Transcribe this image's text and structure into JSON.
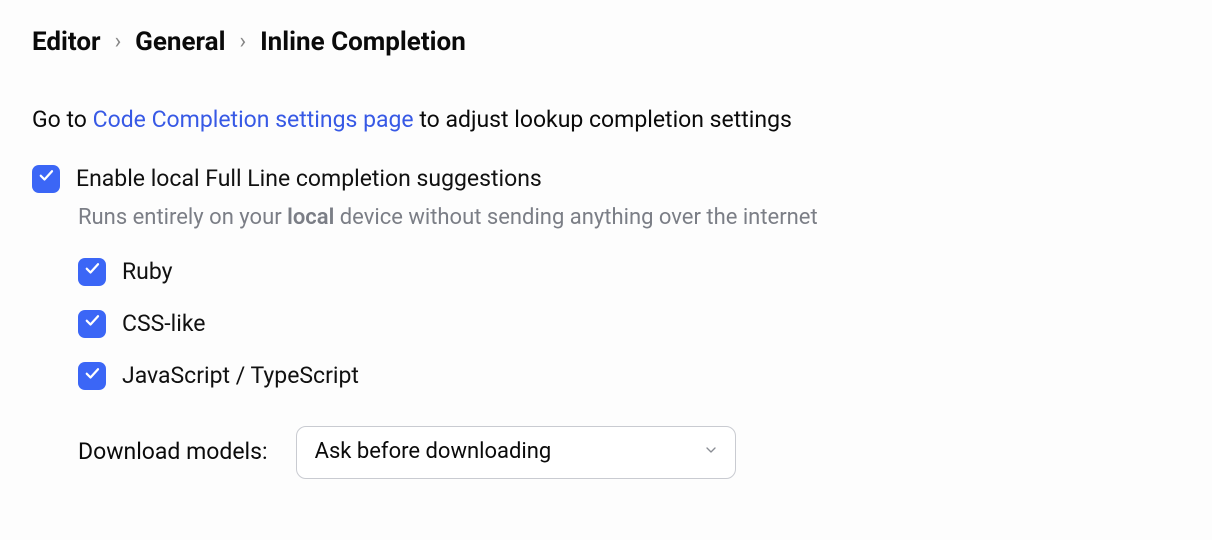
{
  "breadcrumb": {
    "items": [
      "Editor",
      "General",
      "Inline Completion"
    ]
  },
  "intro": {
    "prefix": "Go to ",
    "link": "Code Completion settings page",
    "suffix": " to adjust lookup completion settings"
  },
  "mainOption": {
    "label": "Enable local Full Line completion suggestions",
    "checked": true,
    "hint_prefix": "Runs entirely on your ",
    "hint_bold": "local",
    "hint_suffix": " device without sending anything over the internet"
  },
  "languages": [
    {
      "label": "Ruby",
      "checked": true
    },
    {
      "label": "CSS-like",
      "checked": true
    },
    {
      "label": "JavaScript / TypeScript",
      "checked": true
    }
  ],
  "download": {
    "label": "Download models:",
    "selected": "Ask before downloading"
  }
}
